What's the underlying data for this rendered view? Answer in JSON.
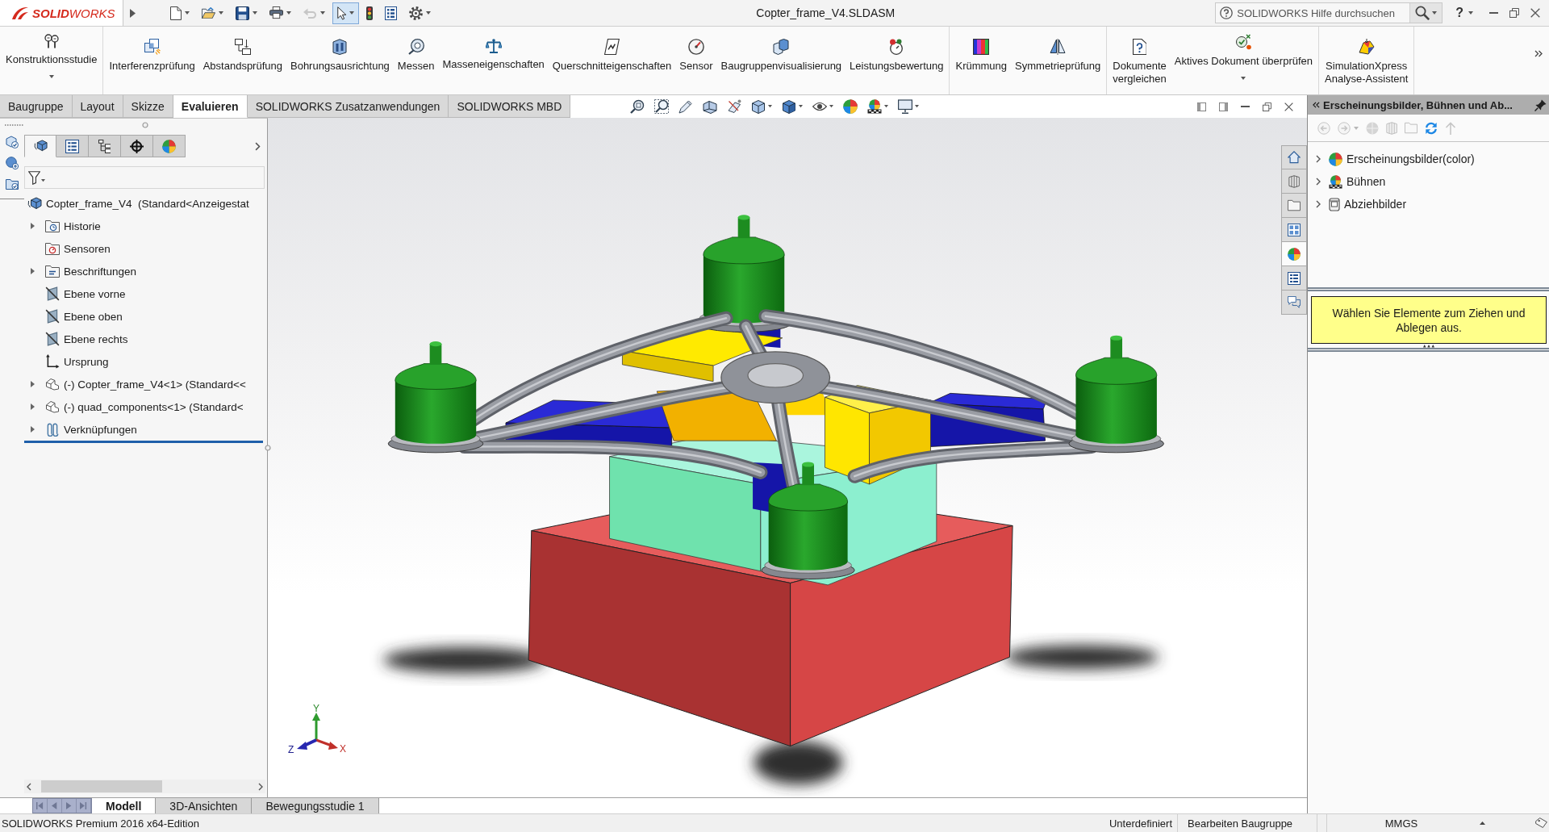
{
  "title_bar": {
    "logo": "**SOLID**WORKS",
    "title": "Copter_frame_V4.SLDASM",
    "search": {
      "placeholder": "SOLIDWORKS Hilfe durchsuchen"
    },
    "help": "?"
  },
  "quick_access": [
    {
      "dropdown": true,
      "disabled": false,
      "selected": false
    },
    {
      "dropdown": true,
      "disabled": false,
      "selected": false
    },
    {
      "dropdown": true,
      "disabled": false,
      "selected": false
    },
    {
      "dropdown": true,
      "disabled": false,
      "selected": false
    },
    {
      "dropdown": true,
      "disabled": true,
      "selected": false
    },
    {
      "dropdown": true,
      "disabled": false,
      "selected": true
    },
    {
      "dropdown": false,
      "disabled": false,
      "selected": false
    },
    {
      "dropdown": false,
      "disabled": false,
      "selected": false
    },
    {
      "dropdown": true,
      "disabled": false,
      "selected": false
    }
  ],
  "ribbon": {
    "groups": [
      {
        "commands": [
          {
            "label": "Konstruktionsstudie",
            "dropdown": true
          }
        ]
      },
      {
        "commands": [
          {
            "label": "Interferenzprüfung",
            "dropdown": false
          },
          {
            "label": "Abstandsprüfung",
            "dropdown": false
          },
          {
            "label": "Bohrungsausrichtung",
            "dropdown": false
          },
          {
            "label": "Messen",
            "dropdown": false
          },
          {
            "label": "Masseneigenschaften",
            "dropdown": false
          },
          {
            "label": "Querschnitteigenschaften",
            "dropdown": false
          },
          {
            "label": "Sensor",
            "dropdown": false
          },
          {
            "label": "Baugruppenvisualisierung",
            "dropdown": false
          },
          {
            "label": "Leistungsbewertung",
            "dropdown": false
          }
        ]
      },
      {
        "commands": [
          {
            "label": "Krümmung",
            "dropdown": false
          },
          {
            "label": "Symmetrieprüfung",
            "dropdown": false
          }
        ]
      },
      {
        "commands": [
          {
            "label": "Dokumente\nvergleichen",
            "dropdown": false
          },
          {
            "label": "Aktives Dokument überprüfen",
            "dropdown": true
          }
        ]
      },
      {
        "commands": [
          {
            "label": "SimulationXpress\nAnalyse-Assistent",
            "dropdown": false
          }
        ]
      }
    ]
  },
  "tabs": [
    {
      "label": "Baugruppe",
      "selected": false
    },
    {
      "label": "Layout",
      "selected": false
    },
    {
      "label": "Skizze",
      "selected": false
    },
    {
      "label": "Evaluieren",
      "selected": true
    },
    {
      "label": "SOLIDWORKS Zusatzanwendungen",
      "selected": false
    },
    {
      "label": "SOLIDWORKS MBD",
      "selected": false
    }
  ],
  "view_toolbar": [
    {
      "dropdown": false
    },
    {
      "dropdown": false
    },
    {
      "dropdown": false
    },
    {
      "dropdown": false
    },
    {
      "dropdown": false
    },
    {
      "dropdown": true
    },
    {
      "dropdown": true
    },
    {
      "dropdown": true
    },
    {
      "dropdown": false
    },
    {
      "dropdown": true
    },
    {
      "dropdown": true
    }
  ],
  "feature_manager": {
    "tabs": [
      {
        "selected": true
      },
      {
        "selected": false
      },
      {
        "selected": false
      },
      {
        "selected": false
      },
      {
        "selected": false
      }
    ],
    "tree": {
      "label": "Copter_frame_V4  (Standard<Anzeigestat",
      "kind": "assembly",
      "children": [
        {
          "label": "Historie",
          "kind": "history",
          "has_children": true,
          "expanded": false
        },
        {
          "label": "Sensoren",
          "kind": "sensors",
          "has_children": false,
          "expanded": false
        },
        {
          "label": "Beschriftungen",
          "kind": "annotations",
          "has_children": true,
          "expanded": false
        },
        {
          "label": "Ebene vorne",
          "kind": "plane",
          "has_children": false,
          "expanded": false
        },
        {
          "label": "Ebene oben",
          "kind": "plane",
          "has_children": false,
          "expanded": false
        },
        {
          "label": "Ebene rechts",
          "kind": "plane",
          "has_children": false,
          "expanded": false
        },
        {
          "label": "Ursprung",
          "kind": "origin",
          "has_children": false,
          "expanded": false
        },
        {
          "label": "(-) Copter_frame_V4<1> (Standard<<",
          "kind": "component",
          "has_children": true,
          "expanded": false
        },
        {
          "label": "(-) quad_components<1> (Standard<",
          "kind": "component",
          "has_children": true,
          "expanded": false
        },
        {
          "label": "Verknüpfungen",
          "kind": "mates",
          "has_children": true,
          "expanded": false
        }
      ]
    }
  },
  "viewport": {
    "triad": {
      "x": "X",
      "y": "Y",
      "z": "Z"
    }
  },
  "task_pane_tabs": [
    {
      "selected": false
    },
    {
      "selected": false
    },
    {
      "selected": false
    },
    {
      "selected": false
    },
    {
      "selected": true
    },
    {
      "selected": false
    },
    {
      "selected": false
    }
  ],
  "task_pane": {
    "title": "Erscheinungsbilder, Bühnen und Ab...",
    "toolbar": [
      {
        "disabled": true,
        "dropdown": false
      },
      {
        "disabled": true,
        "dropdown": true
      },
      {
        "disabled": true,
        "dropdown": false
      },
      {
        "disabled": true,
        "dropdown": false
      },
      {
        "disabled": true,
        "dropdown": false
      },
      {
        "disabled": false,
        "dropdown": false
      },
      {
        "disabled": true,
        "dropdown": false
      }
    ],
    "items": [
      {
        "label": "Erscheinungsbilder(color)",
        "kind": "appearances",
        "expanded": false
      },
      {
        "label": "Bühnen",
        "kind": "scenes",
        "expanded": false
      },
      {
        "label": "Abziehbilder",
        "kind": "decals",
        "expanded": false
      }
    ],
    "message": "Wählen Sie Elemente zum Ziehen und Ablegen aus."
  },
  "bottom_tabs": [
    {
      "label": "Modell",
      "selected": true
    },
    {
      "label": "3D-Ansichten",
      "selected": false
    },
    {
      "label": "Bewegungsstudie 1",
      "selected": false
    }
  ],
  "status_bar": {
    "product": "SOLIDWORKS Premium 2016 x64-Edition",
    "definition": "Unterdefiniert",
    "mode": "Bearbeiten Baugruppe",
    "units": "MMGS"
  }
}
